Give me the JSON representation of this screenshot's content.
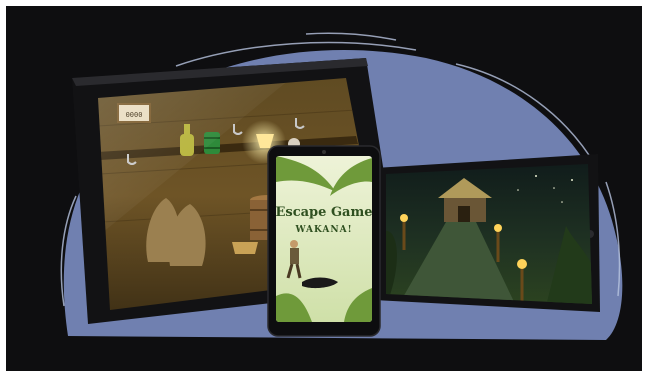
{
  "promo": {
    "game_title": "Escape Game",
    "game_subtitle": "WAKANA!",
    "inventory_code": "0000"
  },
  "colors": {
    "background": "#0e0e10",
    "blob": "#7080b0",
    "cellar_wall": "#6a5024",
    "jungle_night": "#24361c",
    "phone_screen": "#dfe8c4"
  },
  "icons": {
    "inventory_box": "code-plaque-icon",
    "items": [
      "bottle-icon",
      "green-barrel-icon",
      "lamp-icon"
    ],
    "scene_props": [
      "sack-icon",
      "wooden-barrel-icon",
      "basket-icon",
      "torch-icon",
      "hut-icon",
      "explorer-icon"
    ]
  }
}
